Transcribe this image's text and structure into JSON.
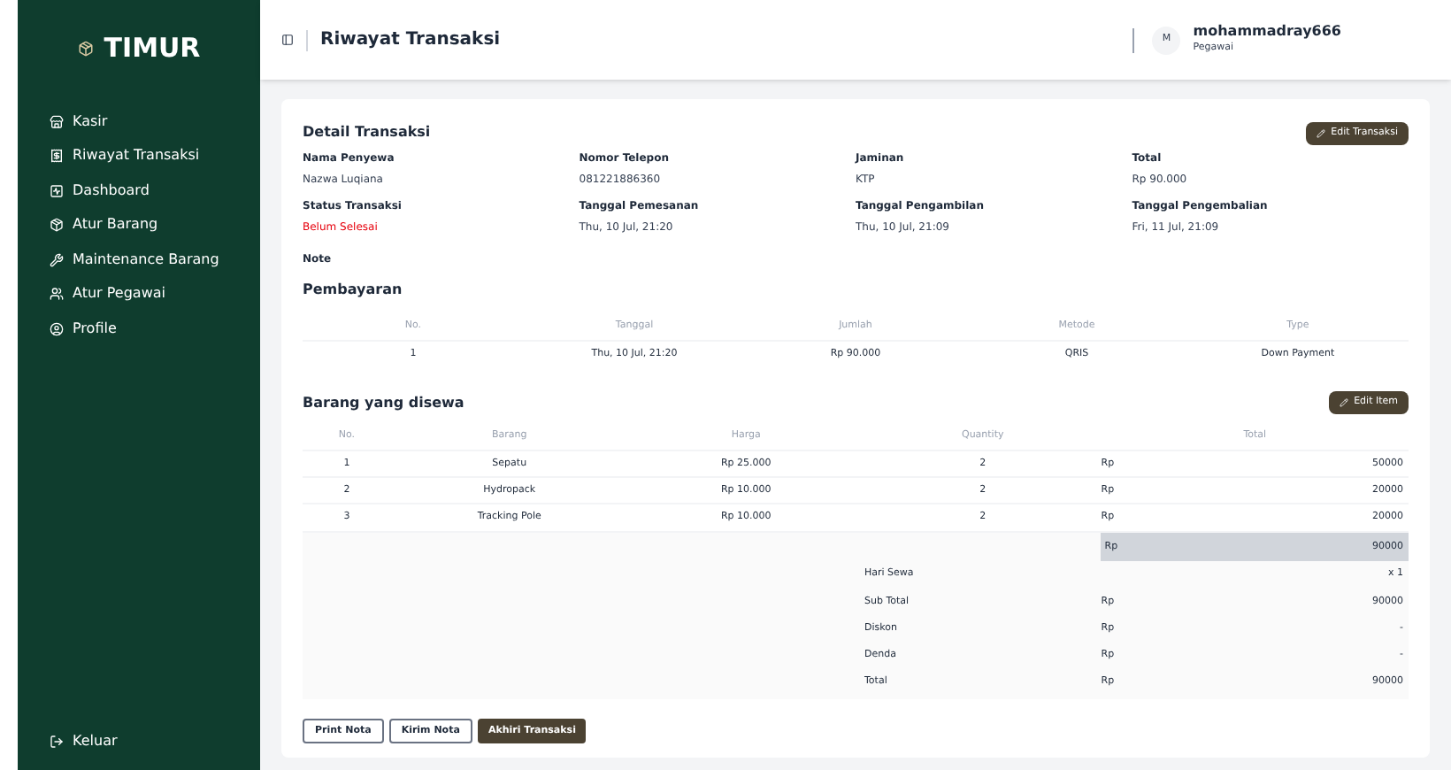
{
  "sidebar": {
    "brand": "TIMUR",
    "items": [
      {
        "label": "Kasir"
      },
      {
        "label": "Riwayat Transaksi"
      },
      {
        "label": "Dashboard"
      },
      {
        "label": "Atur Barang"
      },
      {
        "label": "Maintenance Barang"
      },
      {
        "label": "Atur Pegawai"
      },
      {
        "label": "Profile"
      }
    ],
    "logout": "Keluar"
  },
  "header": {
    "title": "Riwayat Transaksi",
    "user": {
      "initial": "M",
      "name": "mohammadray666",
      "role": "Pegawai"
    }
  },
  "detail": {
    "title": "Detail Transaksi",
    "edit_button": "Edit Transaksi",
    "fields": [
      {
        "label": "Nama Penyewa",
        "value": "Nazwa Luqiana",
        "kind": "plain"
      },
      {
        "label": "Nomor Telepon",
        "value": "081221886360",
        "kind": "plain"
      },
      {
        "label": "Jaminan",
        "value": "KTP",
        "kind": "plain"
      },
      {
        "label": "Total",
        "value": "Rp 90.000",
        "kind": "plain"
      },
      {
        "label": "Status Transaksi",
        "value": "Belum Selesai",
        "kind": "alert"
      },
      {
        "label": "Tanggal Pemesanan",
        "value": "Thu, 10 Jul, 21:20",
        "kind": "plain"
      },
      {
        "label": "Tanggal Pengambilan",
        "value": "Thu, 10 Jul, 21:09",
        "kind": "plain"
      },
      {
        "label": "Tanggal Pengembalian",
        "value": "Fri, 11 Jul, 21:09",
        "kind": "plain"
      }
    ],
    "note_label": "Note"
  },
  "payments": {
    "title": "Pembayaran",
    "columns": [
      "No.",
      "Tanggal",
      "Jumlah",
      "Metode",
      "Type"
    ],
    "rows": [
      [
        "1",
        "Thu, 10 Jul, 21:20",
        "Rp 90.000",
        "QRIS",
        "Down Payment"
      ]
    ]
  },
  "items": {
    "title": "Barang yang disewa",
    "edit_button": "Edit Item",
    "columns": [
      "No.",
      "Barang",
      "Harga",
      "Quantity",
      "Total"
    ],
    "rows": [
      {
        "no": "1",
        "name": "Sepatu",
        "price": "Rp 25.000",
        "qty": "2",
        "currency": "Rp",
        "total": "50000"
      },
      {
        "no": "2",
        "name": "Hydropack",
        "price": "Rp 10.000",
        "qty": "2",
        "currency": "Rp",
        "total": "20000"
      },
      {
        "no": "3",
        "name": "Tracking Pole",
        "price": "Rp 10.000",
        "qty": "2",
        "currency": "Rp",
        "total": "20000"
      }
    ],
    "grand": {
      "currency": "Rp",
      "total": "90000"
    },
    "summary": [
      {
        "label": "Hari Sewa",
        "value": "x 1"
      },
      {
        "label": "Sub Total",
        "currency": "Rp",
        "value": "90000"
      },
      {
        "label": "Diskon",
        "currency": "Rp",
        "value": "-"
      },
      {
        "label": "Denda",
        "currency": "Rp",
        "value": "-"
      },
      {
        "label": "Total",
        "currency": "Rp",
        "value": "90000"
      }
    ]
  },
  "actions": [
    {
      "label": "Print Nota",
      "kind": "outline"
    },
    {
      "label": "Kirim Nota",
      "kind": "outline"
    },
    {
      "label": "Akhiri Transaksi",
      "kind": "solid"
    }
  ]
}
